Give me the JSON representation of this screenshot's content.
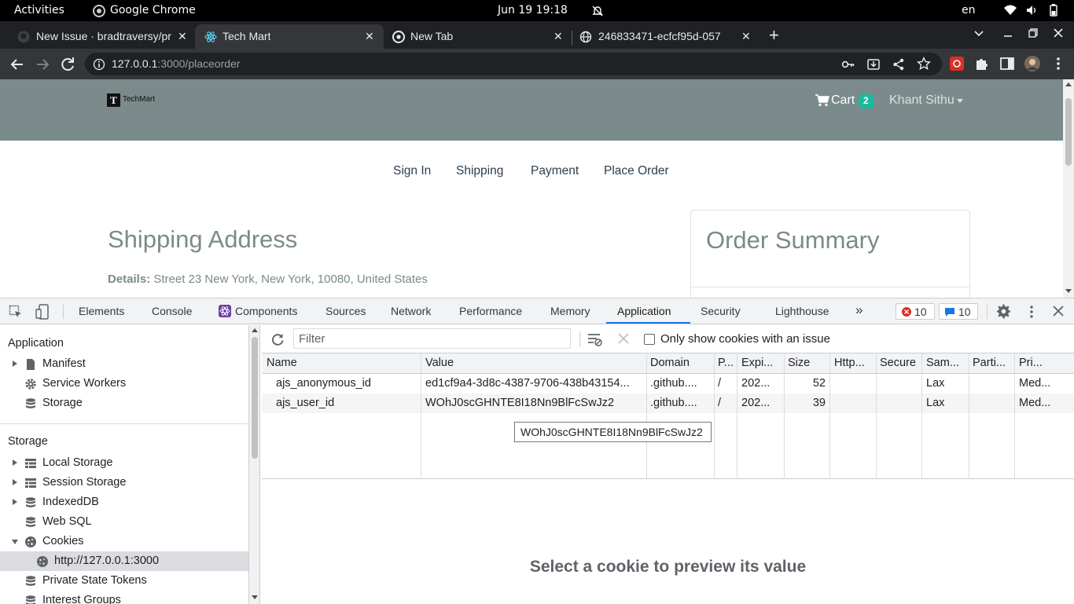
{
  "system_bar": {
    "activities": "Activities",
    "app_name": "Google Chrome",
    "datetime": "Jun 19  19:18",
    "language": "en"
  },
  "browser": {
    "tabs": [
      {
        "title": "New Issue · bradtraversy/pr",
        "icon": "github-icon"
      },
      {
        "title": "Tech Mart",
        "icon": "react-icon"
      },
      {
        "title": "New Tab",
        "icon": "chrome-icon"
      },
      {
        "title": "246833471-ecfcf95d-057",
        "icon": "globe-icon"
      }
    ],
    "url_host": "127.0.0.1",
    "url_rest": ":3000/placeorder"
  },
  "site": {
    "logo_text": "TechMart",
    "cart_label": "Cart",
    "cart_count": "2",
    "user_name": "Khant Sithu",
    "steps": [
      "Sign In",
      "Shipping",
      "Payment",
      "Place Order"
    ],
    "shipping_title": "Shipping Address",
    "details_label": "Details:",
    "details_value": "Street 23 New York, New York, 10080, United States",
    "order_summary_title": "Order Summary"
  },
  "devtools": {
    "tabs": [
      "Elements",
      "Console",
      "Components",
      "Sources",
      "Network",
      "Performance",
      "Memory",
      "Application",
      "Security",
      "Lighthouse"
    ],
    "active_tab": "Application",
    "error_count": "10",
    "message_count": "10",
    "sidebar": {
      "application_header": "Application",
      "application_items": [
        "Manifest",
        "Service Workers",
        "Storage"
      ],
      "storage_header": "Storage",
      "storage_items": [
        "Local Storage",
        "Session Storage",
        "IndexedDB",
        "Web SQL",
        "Cookies"
      ],
      "cookie_origin": "http://127.0.0.1:3000",
      "more_items": [
        "Private State Tokens",
        "Interest Groups"
      ]
    },
    "cookies": {
      "filter_placeholder": "Filter",
      "only_issues_label": "Only show cookies with an issue",
      "columns": [
        "Name",
        "Value",
        "Domain",
        "P...",
        "Expi...",
        "Size",
        "Http...",
        "Secure",
        "Sam...",
        "Parti...",
        "Pri..."
      ],
      "rows": [
        {
          "name": "ajs_anonymous_id",
          "value": "ed1cf9a4-3d8c-4387-9706-438b43154...",
          "domain": ".github....",
          "path": "/",
          "expires": "202...",
          "size": "52",
          "http": "",
          "secure": "",
          "samesite": "Lax",
          "partition": "",
          "priority": "Med..."
        },
        {
          "name": "ajs_user_id",
          "value": "WOhJ0scGHNTE8I18Nn9BlFcSwJz2",
          "domain": ".github....",
          "path": "/",
          "expires": "202...",
          "size": "39",
          "http": "",
          "secure": "",
          "samesite": "Lax",
          "partition": "",
          "priority": "Med..."
        }
      ],
      "tooltip": "WOhJ0scGHNTE8I18Nn9BlFcSwJz2",
      "preview_message": "Select a cookie to preview its value"
    }
  }
}
